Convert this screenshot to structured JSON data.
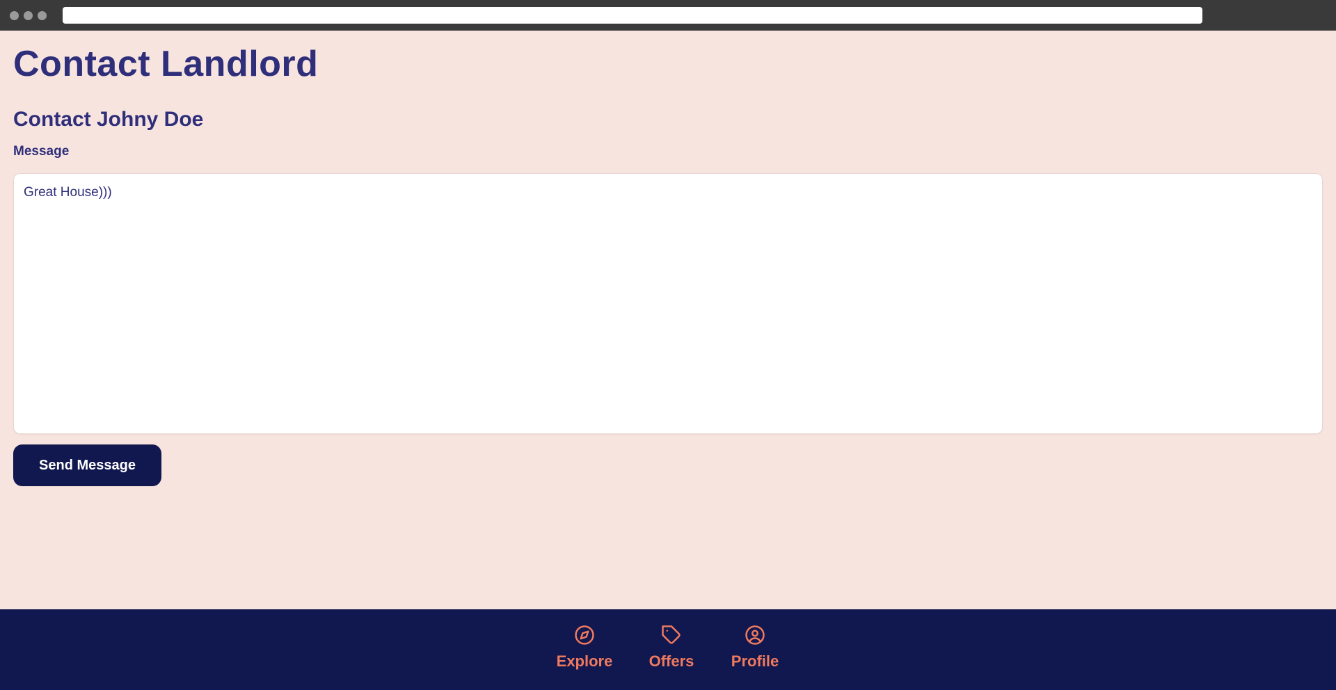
{
  "page": {
    "title": "Contact Landlord",
    "contact_heading": "Contact Johny Doe",
    "message_label": "Message",
    "message_value": "Great House)))",
    "send_label": "Send Message"
  },
  "nav": {
    "items": [
      {
        "label": "Explore",
        "icon": "compass-icon"
      },
      {
        "label": "Offers",
        "icon": "tag-icon"
      },
      {
        "label": "Profile",
        "icon": "user-circle-icon"
      }
    ]
  },
  "colors": {
    "background": "#f8e4df",
    "heading": "#2e2e7a",
    "primary": "#11174f",
    "accent": "#f07a5f"
  }
}
